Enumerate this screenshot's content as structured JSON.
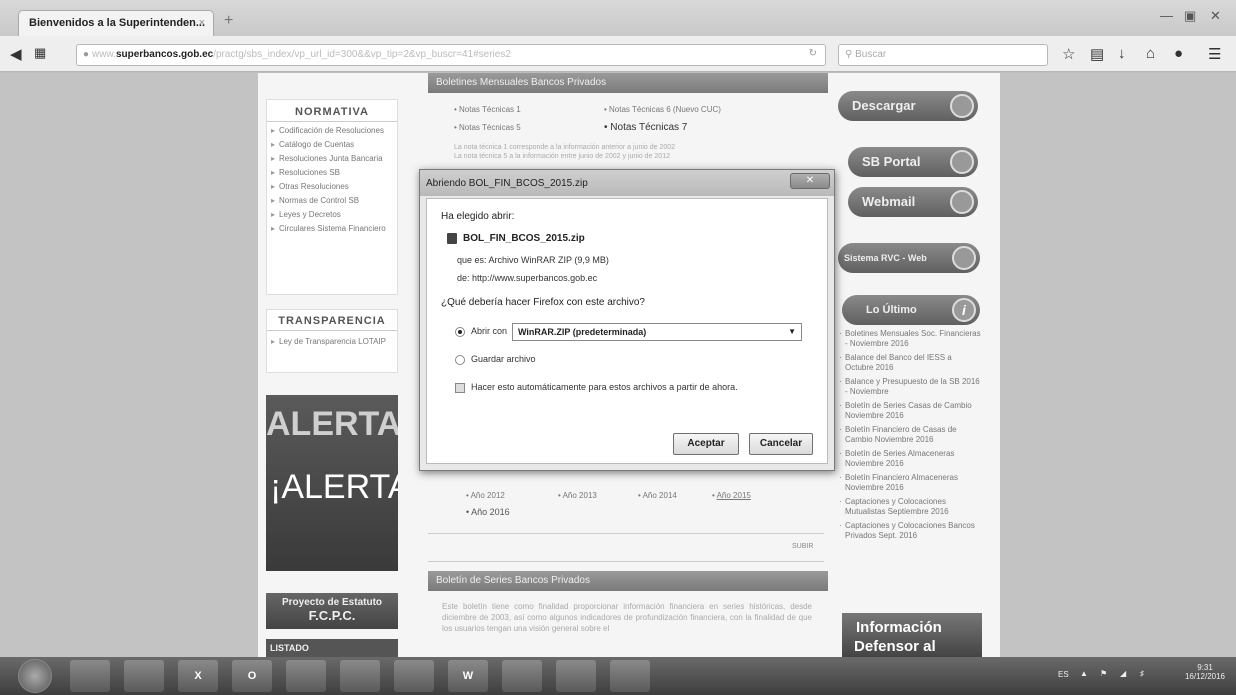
{
  "browser": {
    "tab_title": "Bienvenidos a la Superintenden...",
    "tab_close": "×",
    "new_tab": "+",
    "url_host": "superbancos.gob.ec",
    "url_prefix": "www.",
    "url_path": "/practg/sbs_index/vp_url_id=300&&vp_tip=2&vp_buscr=41#series2",
    "search_placeholder": "Buscar"
  },
  "left_sidebar": {
    "normativa_title": "NORMATIVA",
    "normativa_items": [
      "Codificación de Resoluciones",
      "Catálogo de Cuentas",
      "Resoluciones Junta Bancaria",
      "Resoluciones SB",
      "Otras Resoluciones",
      "Normas de Control SB",
      "Leyes y Decretos",
      "Circulares Sistema Financiero"
    ],
    "transparencia_title": "TRANSPARENCIA",
    "transparencia_items": [
      "Ley de Transparencia LOTAIP"
    ],
    "alerta_1": "ALERTA!",
    "alerta_2": "¡ALERTA!",
    "proyecto_line1": "Proyecto de Estatuto",
    "proyecto_line2": "F.C.P.C.",
    "listado": "LISTADO"
  },
  "center": {
    "boletines_header": "Boletines Mensuales Bancos Privados",
    "notas": [
      "Notas Técnicas 1",
      "Notas Técnicas 6 (Nuevo CUC)",
      "Notas Técnicas 5",
      "Notas Técnicas 7"
    ],
    "nota_text_1": "La nota técnica 1 corresponde a la información anterior a junio de 2002",
    "nota_text_2": "La nota técnica 5 a la información entre junio de 2002 y junio de 2012",
    "years": [
      "Año 2012",
      "Año 2013",
      "Año 2014",
      "Año 2015",
      "Año 2016"
    ],
    "subir": "SUBIR",
    "series_header": "Boletín de Series Bancos Privados",
    "series_text": "Este boletín tiene como finalidad proporcionar información financiera en series históricas, desde diciembre de 2003, así como algunos indicadores de profundización financiera, con la finalidad de que los usuarios tengan una visión general sobre el"
  },
  "right_sidebar": {
    "buttons": [
      "Descargar",
      "SB Portal",
      "Webmail",
      "Sistema RVC - Web"
    ],
    "lo_ultimo": "Lo Último",
    "news": [
      "Boletines Mensuales Soc. Financieras - Noviembre 2016",
      "Balance del Banco del IESS a Octubre 2016",
      "Balance y Presupuesto de la SB 2016 - Noviembre",
      "Boletín de Series Casas de Cambio Noviembre 2016",
      "Boletín Financiero de Casas de Cambio Noviembre 2016",
      "Boletín de Series Almaceneras Noviembre 2016",
      "Boletín Financiero Almaceneras Noviembre 2016",
      "Captaciones y Colocaciones Mutualistas Septiembre 2016",
      "Captaciones y Colocaciones Bancos Privados Sept. 2016"
    ],
    "info_line1": "Información",
    "info_line2": "Defensor al"
  },
  "dialog": {
    "title": "Abriendo BOL_FIN_BCOS_2015.zip",
    "chosen_label": "Ha elegido abrir:",
    "filename": "BOL_FIN_BCOS_2015.zip",
    "type_label": "que es:",
    "type_value": "Archivo WinRAR ZIP (9,9 MB)",
    "from_label": "de:",
    "from_value": "http://www.superbancos.gob.ec",
    "question": "¿Qué debería hacer Firefox con este archivo?",
    "open_with_label": "Abrir con",
    "open_with_value": "WinRAR.ZIP (predeterminada)",
    "save_label": "Guardar archivo",
    "auto_label": "Hacer esto automáticamente para estos archivos a partir de ahora.",
    "accept": "Aceptar",
    "cancel": "Cancelar",
    "close": "✕"
  },
  "taskbar": {
    "apps": [
      "",
      "",
      "",
      "X",
      "O",
      "",
      "",
      "",
      "W",
      "",
      "",
      ""
    ],
    "lang": "ES",
    "time": "9:31",
    "date": "16/12/2016"
  }
}
